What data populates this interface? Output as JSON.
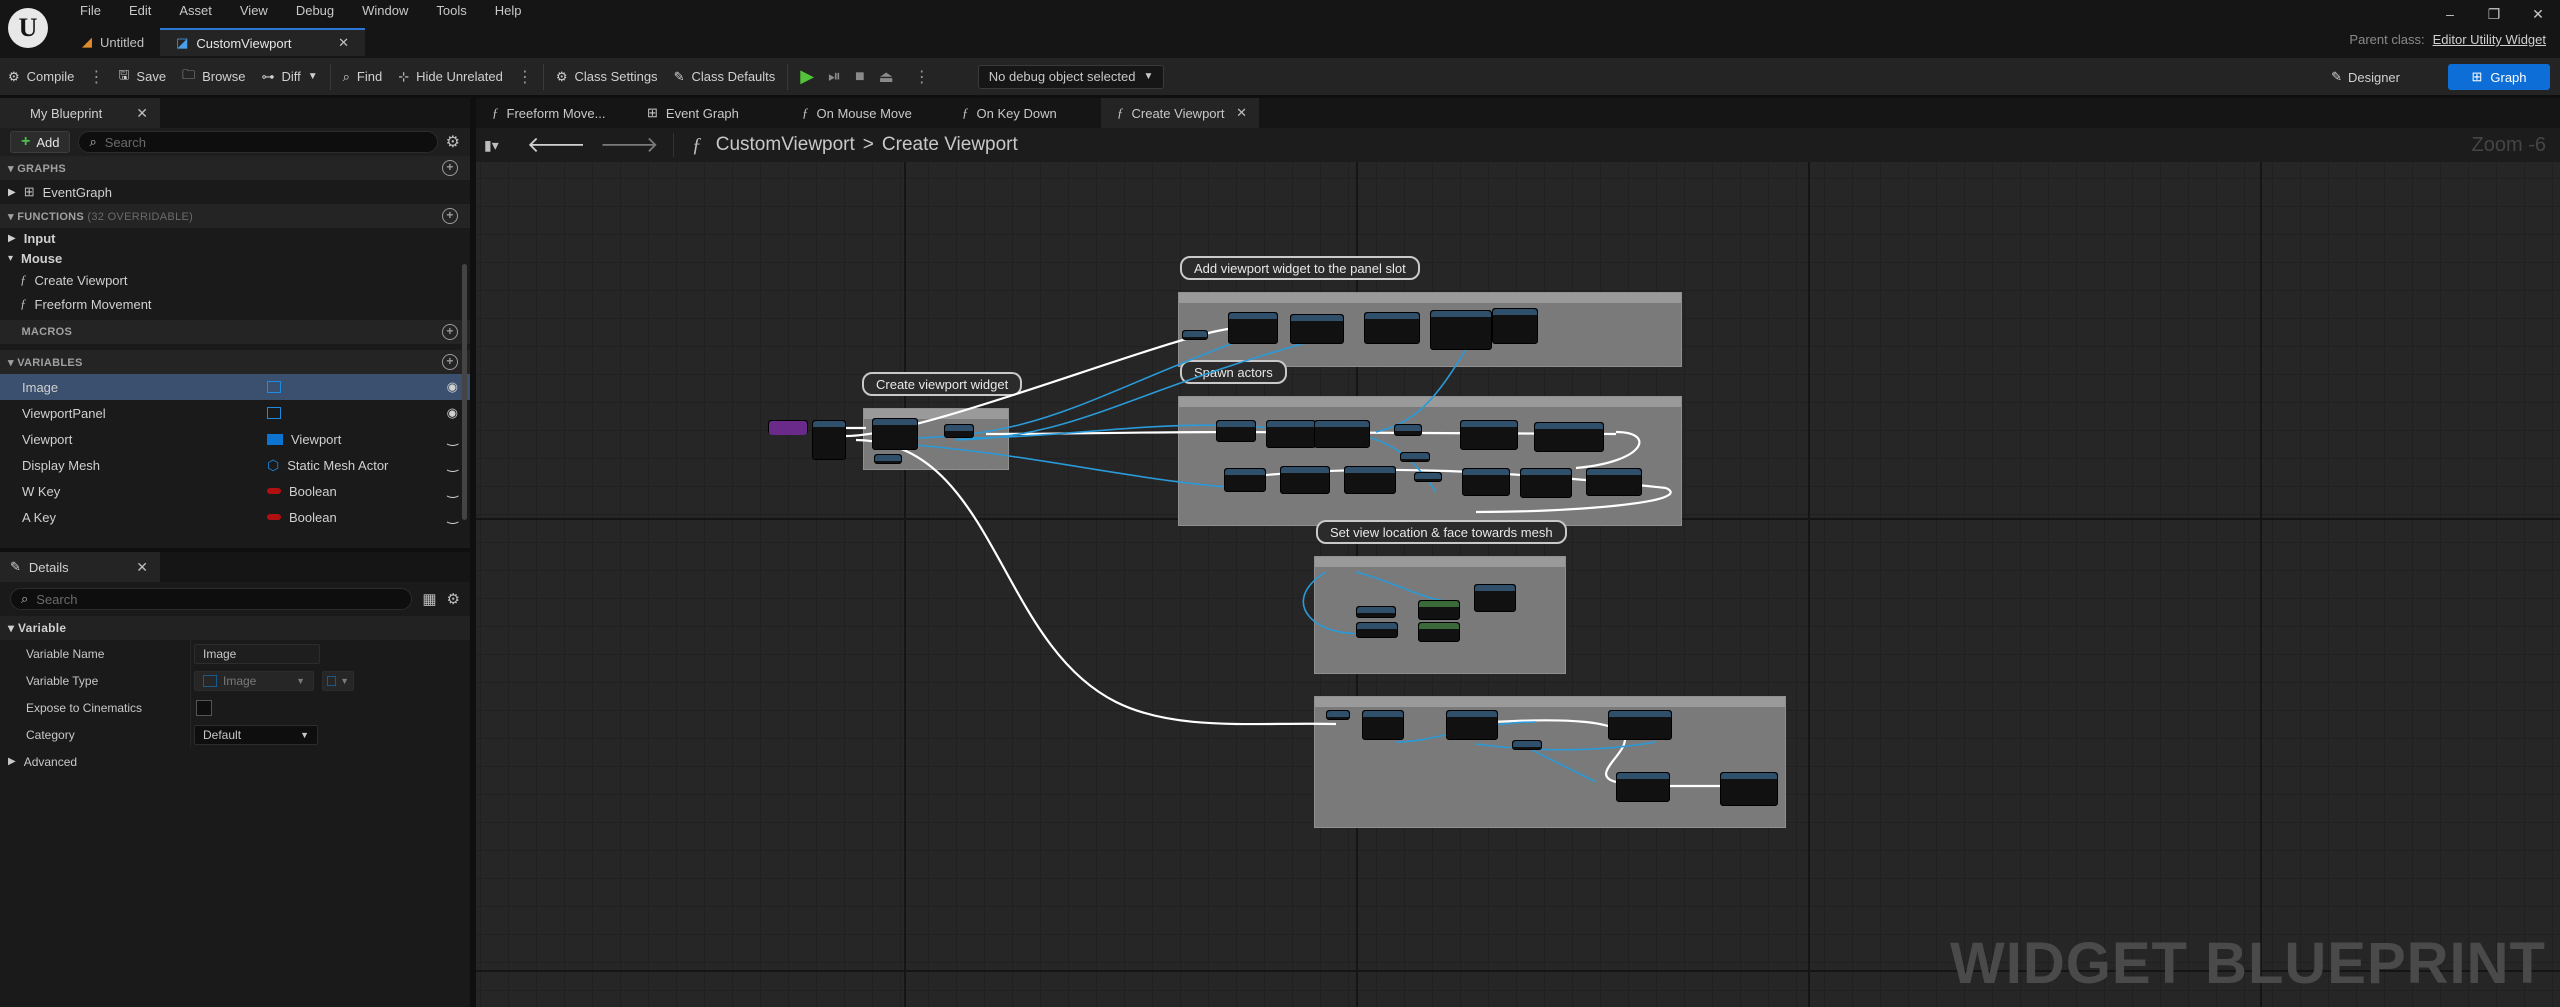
{
  "menu": [
    "File",
    "Edit",
    "Asset",
    "View",
    "Debug",
    "Window",
    "Tools",
    "Help"
  ],
  "logo": "U",
  "doc_tabs": [
    {
      "label": "Untitled"
    },
    {
      "label": "CustomViewport"
    }
  ],
  "window_controls": {
    "minimize": "–",
    "restore": "❐",
    "close": "✕"
  },
  "parent_class": {
    "label": "Parent class:",
    "value": "Editor Utility Widget"
  },
  "toolbar": {
    "compile": "Compile",
    "save": "Save",
    "browse": "Browse",
    "diff": "Diff",
    "find": "Find",
    "hide_unrelated": "Hide Unrelated",
    "class_settings": "Class Settings",
    "class_defaults": "Class Defaults",
    "debug_object": "No debug object selected",
    "designer": "Designer",
    "graph": "Graph"
  },
  "my_blueprint": {
    "tab": "My Blueprint",
    "add": "Add",
    "search_placeholder": "Search",
    "graphs_header": "GRAPHS",
    "graphs": [
      "EventGraph"
    ],
    "functions_header": "FUNCTIONS",
    "functions_sub": "(32 OVERRIDABLE)",
    "function_groups": [
      "Input",
      "Mouse"
    ],
    "functions": [
      "Create Viewport",
      "Freeform Movement"
    ],
    "macros_header": "MACROS",
    "variables_header": "VARIABLES",
    "variables": [
      {
        "name": "Image",
        "type": "",
        "icon": "image-icon",
        "selected": true,
        "visibility": "eye-icon"
      },
      {
        "name": "ViewportPanel",
        "type": "",
        "icon": "image-icon",
        "selected": false,
        "visibility": "eye-icon"
      },
      {
        "name": "Viewport",
        "type": "Viewport",
        "icon": "viewport-icon",
        "selected": false,
        "visibility": "closed-eye-icon"
      },
      {
        "name": "Display Mesh",
        "type": "Static Mesh Actor",
        "icon": "static-mesh-icon",
        "selected": false,
        "visibility": "closed-eye-icon"
      },
      {
        "name": "W Key",
        "type": "Boolean",
        "icon": "boolean-pill-icon",
        "selected": false,
        "visibility": "closed-eye-icon"
      },
      {
        "name": "A Key",
        "type": "Boolean",
        "icon": "boolean-pill-icon",
        "selected": false,
        "visibility": "closed-eye-icon"
      }
    ]
  },
  "details": {
    "tab": "Details",
    "search_placeholder": "Search",
    "section": "Variable",
    "rows": [
      {
        "label": "Variable Name",
        "value": "Image"
      },
      {
        "label": "Variable Type",
        "value": "Image"
      },
      {
        "label": "Expose to Cinematics",
        "value": ""
      },
      {
        "label": "Category",
        "value": "Default"
      }
    ],
    "advanced": "Advanced"
  },
  "graph_tabs": [
    {
      "label": "Freeform Move...",
      "active": false
    },
    {
      "label": "Event Graph",
      "active": false
    },
    {
      "label": "On Mouse Move",
      "active": false
    },
    {
      "label": "On Key Down",
      "active": false
    },
    {
      "label": "Create Viewport",
      "active": true
    }
  ],
  "breadcrumb": {
    "root": "CustomViewport",
    "separator": ">",
    "leaf": "Create Viewport"
  },
  "zoom": "Zoom -6",
  "watermark": "WIDGET BLUEPRINT",
  "comments": [
    "Create viewport widget",
    "Add viewport widget to the panel slot",
    "Spawn actors",
    "Set view location & face towards mesh"
  ],
  "colors": {
    "accent": "#0d6ed8",
    "exec_wire": "#ffffff",
    "data_wire": "#2a9ad8",
    "comment_box": "#7a7a7a"
  }
}
